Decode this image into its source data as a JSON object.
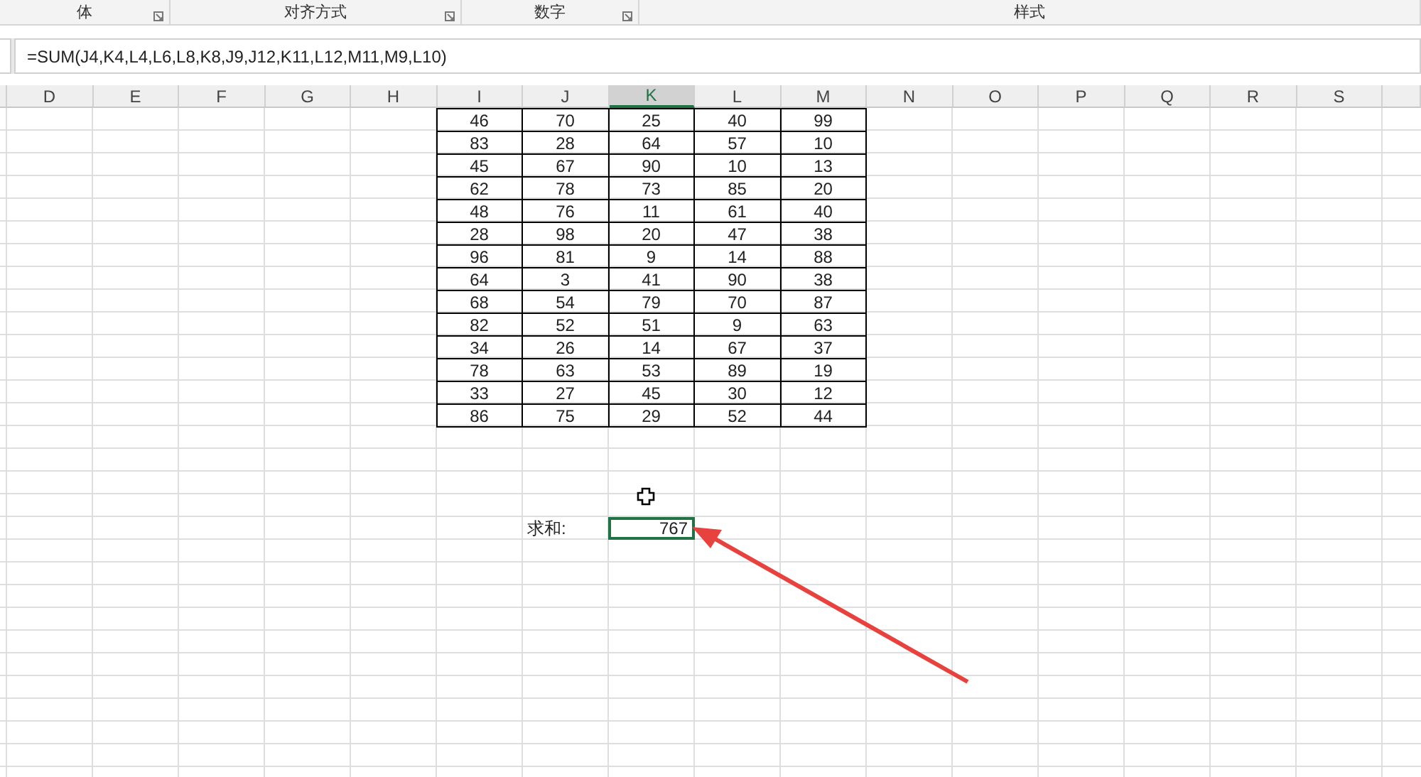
{
  "ribbon_groups": [
    {
      "label": "体"
    },
    {
      "label": "对齐方式"
    },
    {
      "label": "数字"
    },
    {
      "label": "样式"
    }
  ],
  "formula_bar": {
    "formula": "=SUM(J4,K4,L4,L6,L8,K8,J9,J12,K11,L12,M11,M9,L10)"
  },
  "columns": [
    {
      "label": "D",
      "selected": false
    },
    {
      "label": "E",
      "selected": false
    },
    {
      "label": "F",
      "selected": false
    },
    {
      "label": "G",
      "selected": false
    },
    {
      "label": "H",
      "selected": false
    },
    {
      "label": "I",
      "selected": false
    },
    {
      "label": "J",
      "selected": false
    },
    {
      "label": "K",
      "selected": true
    },
    {
      "label": "L",
      "selected": false
    },
    {
      "label": "M",
      "selected": false
    },
    {
      "label": "N",
      "selected": false
    },
    {
      "label": "O",
      "selected": false
    },
    {
      "label": "P",
      "selected": false
    },
    {
      "label": "Q",
      "selected": false
    },
    {
      "label": "R",
      "selected": false
    },
    {
      "label": "S",
      "selected": false
    }
  ],
  "table": {
    "rows": [
      [
        "46",
        "70",
        "25",
        "40",
        "99"
      ],
      [
        "83",
        "28",
        "64",
        "57",
        "10"
      ],
      [
        "45",
        "67",
        "90",
        "10",
        "13"
      ],
      [
        "62",
        "78",
        "73",
        "85",
        "20"
      ],
      [
        "48",
        "76",
        "11",
        "61",
        "40"
      ],
      [
        "28",
        "98",
        "20",
        "47",
        "38"
      ],
      [
        "96",
        "81",
        "9",
        "14",
        "88"
      ],
      [
        "64",
        "3",
        "41",
        "90",
        "38"
      ],
      [
        "68",
        "54",
        "79",
        "70",
        "87"
      ],
      [
        "82",
        "52",
        "51",
        "9",
        "63"
      ],
      [
        "34",
        "26",
        "14",
        "67",
        "37"
      ],
      [
        "78",
        "63",
        "53",
        "89",
        "19"
      ],
      [
        "33",
        "27",
        "45",
        "30",
        "12"
      ],
      [
        "86",
        "75",
        "29",
        "52",
        "44"
      ]
    ]
  },
  "sum": {
    "label": "求和:",
    "value": "767",
    "selected": true
  }
}
